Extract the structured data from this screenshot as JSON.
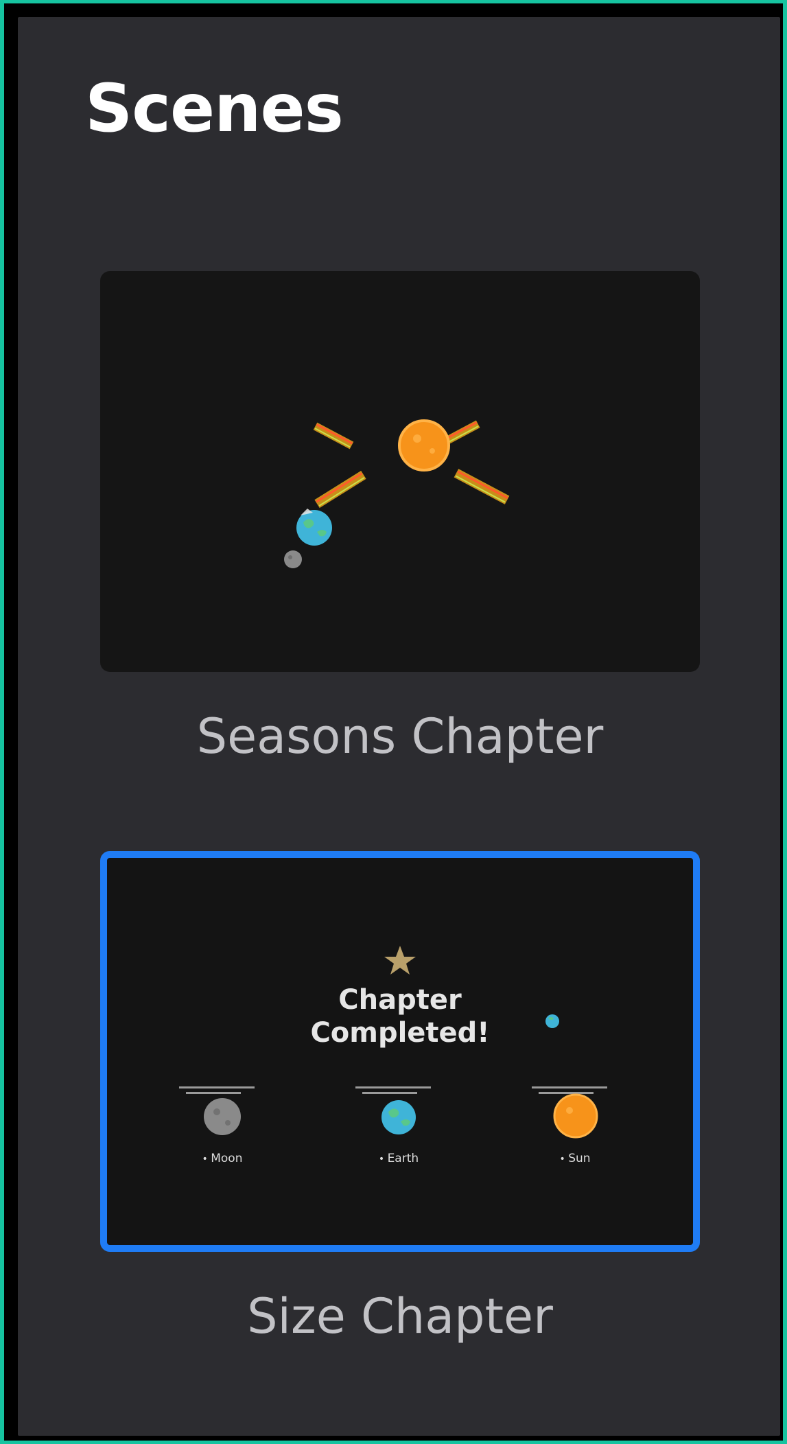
{
  "panel": {
    "title": "Scenes"
  },
  "scenes": [
    {
      "label": "Seasons Chapter",
      "selected": false,
      "thumbnail": {
        "objects": [
          "sun",
          "earth",
          "moon",
          "sun-rays"
        ]
      }
    },
    {
      "label": "Size Chapter",
      "selected": true,
      "thumbnail": {
        "heading_line1": "Chapter",
        "heading_line2": "Completed!",
        "bodies": [
          {
            "name": "Moon"
          },
          {
            "name": "Earth"
          },
          {
            "name": "Sun"
          }
        ]
      }
    }
  ],
  "colors": {
    "background_accent": "#16c4a0",
    "panel": "#2c2c30",
    "selection": "#1f7cf5",
    "sun": "#f7931a",
    "earth": "#3fb4d8",
    "moon": "#8a8a8a"
  }
}
